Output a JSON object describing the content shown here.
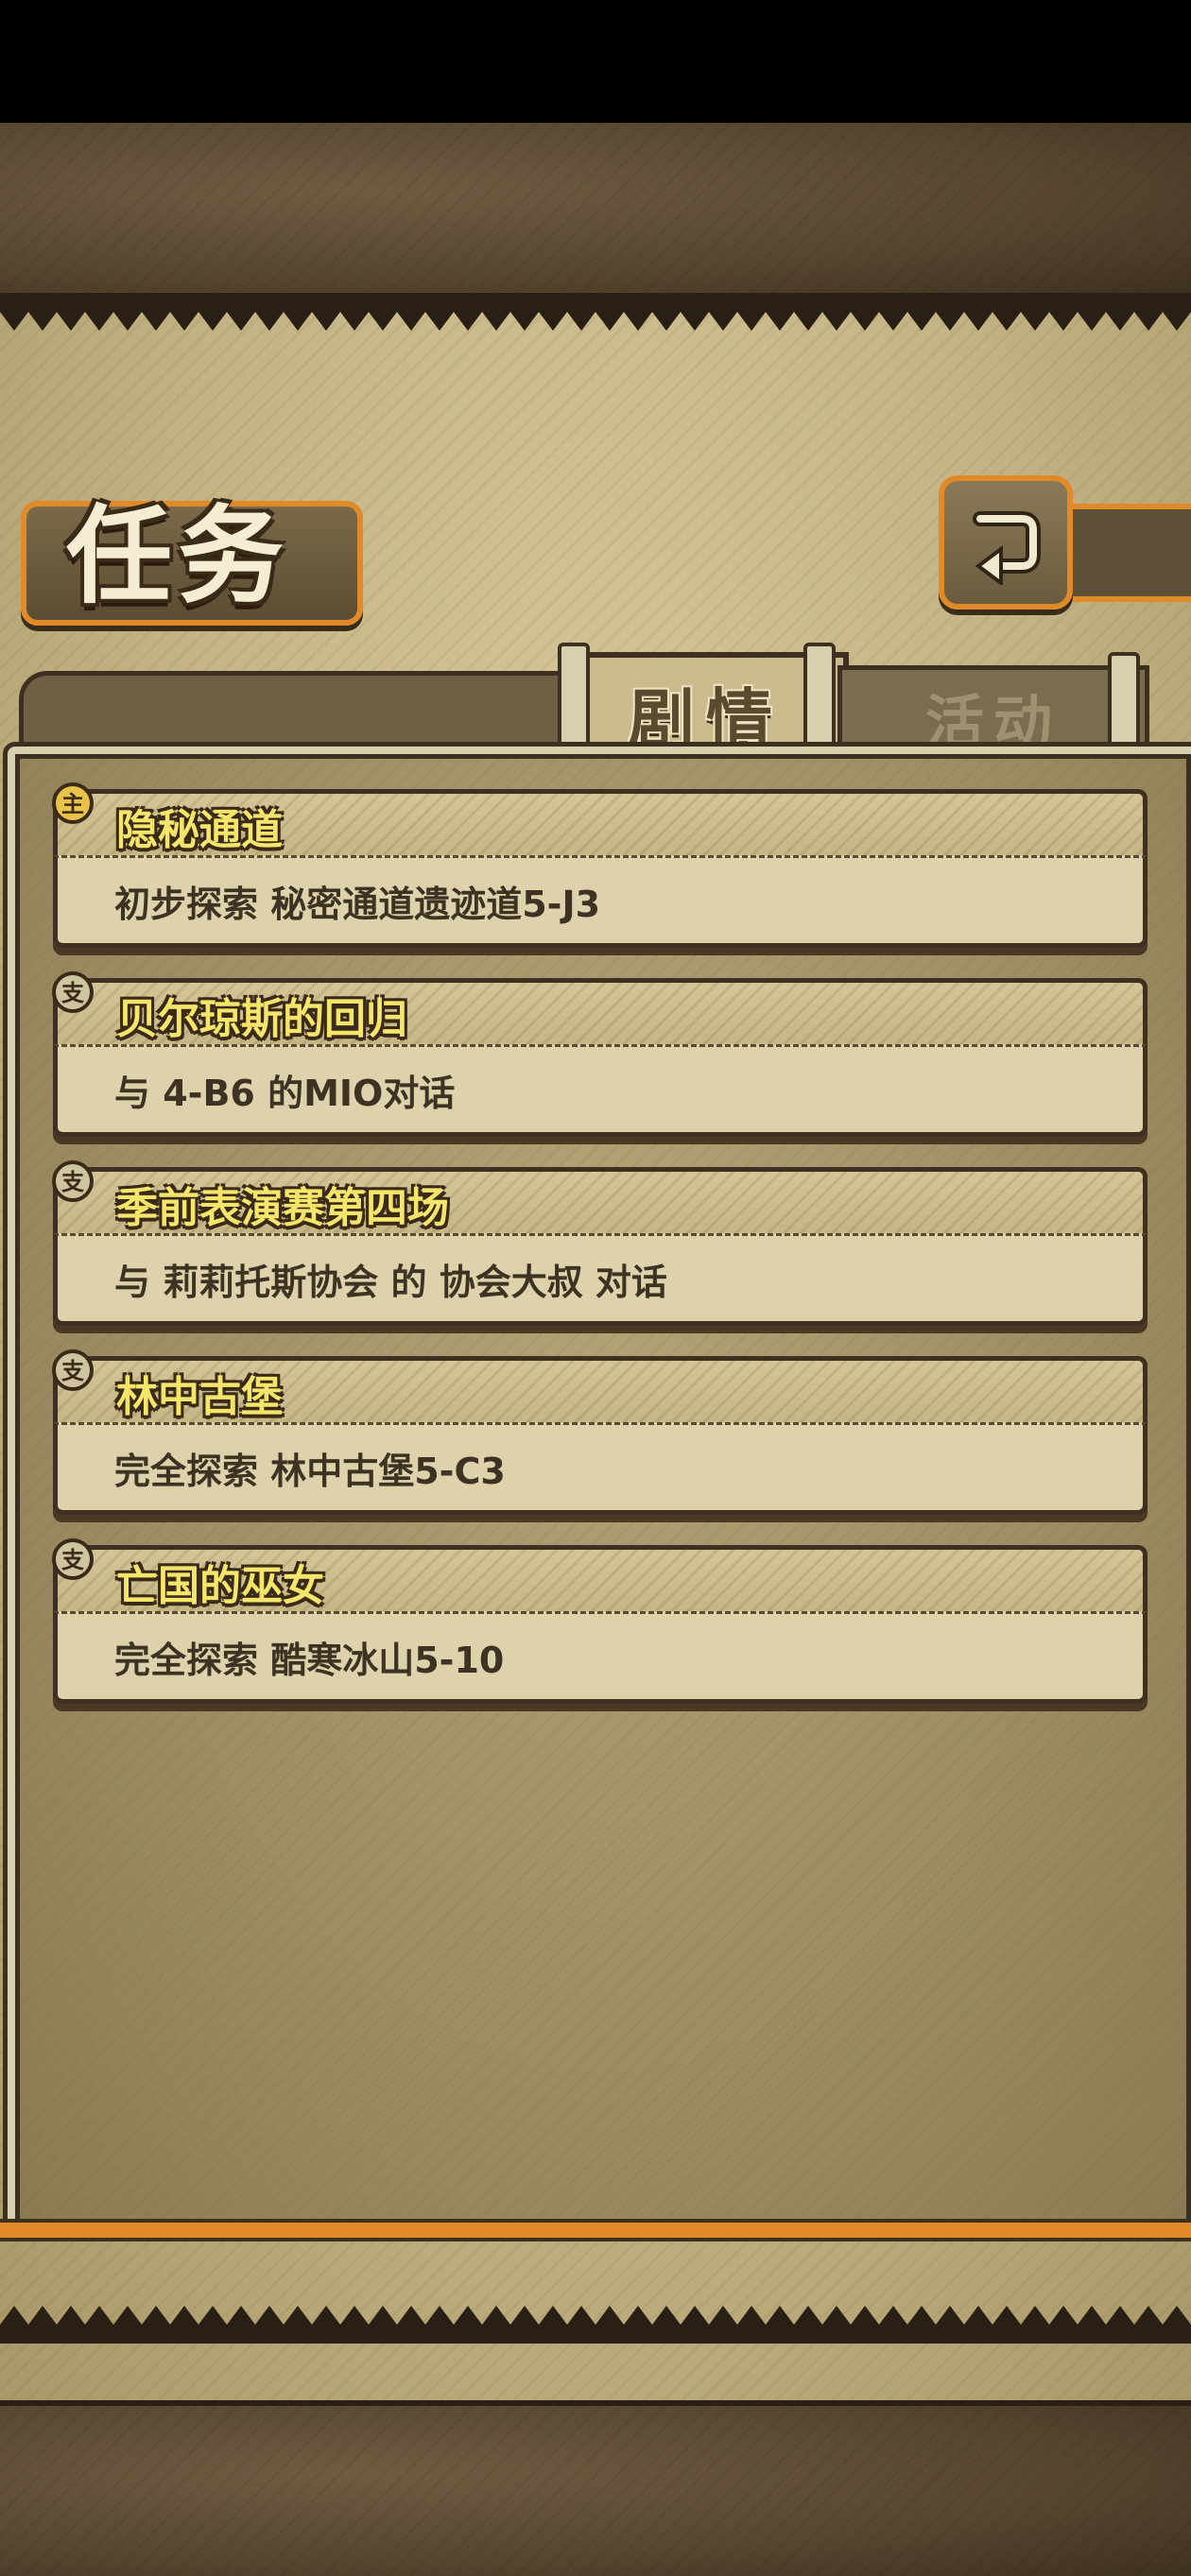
{
  "screen": {
    "title": "任务",
    "back_button": "back-arrow-icon"
  },
  "tabs": [
    {
      "label": "剧情",
      "active": true
    },
    {
      "label": "活动",
      "active": false
    }
  ],
  "quests": [
    {
      "badge": "主",
      "title": "隐秘通道",
      "description": "初步探索 秘密通道遗迹道5-J3"
    },
    {
      "badge": "支",
      "title": "贝尔琼斯的回归",
      "description": "与 4-B6 的MIO对话"
    },
    {
      "badge": "支",
      "title": "季前表演赛第四场",
      "description": "与 莉莉托斯协会 的 协会大叔 对话"
    },
    {
      "badge": "支",
      "title": "林中古堡",
      "description": "完全探索 林中古堡5-C3"
    },
    {
      "badge": "支",
      "title": "亡国的巫女",
      "description": "完全探索 酷寒冰山5-10"
    }
  ],
  "colors": {
    "accent_orange": "#e08a2a",
    "title_yellow": "#f5e56a",
    "outline_brown": "#3d3020"
  }
}
